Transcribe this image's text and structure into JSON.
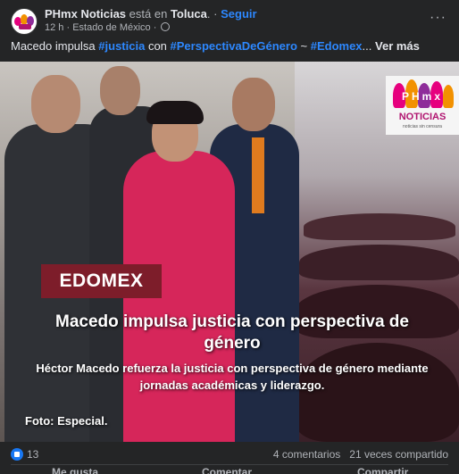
{
  "post": {
    "page_name": "PHmx Noticias",
    "status_text": "está en",
    "location": "Toluca",
    "separator": ".",
    "follow_label": "Seguir",
    "time": "12 h",
    "dot": "·",
    "region": "Estado de México",
    "more_label": "···",
    "caption": {
      "lead": "Macedo impulsa",
      "tag1": "#justicia",
      "mid": "con",
      "tag2": "#PerspectivaDeGénero",
      "tilde": "~",
      "tag3": "#Edomex",
      "ellipsis": "...",
      "see_more": "Ver más"
    }
  },
  "image": {
    "logo_text": "NOTICIAS",
    "logo_letters": "PHmx",
    "logo_small": "noticias sin censura",
    "badge": "EDOMEX",
    "headline": "Macedo impulsa justicia con perspectiva de género",
    "subhead": "Héctor Macedo refuerza la justicia con perspectiva de género mediante jornadas académicas y liderazgo.",
    "credit": "Foto: Especial."
  },
  "stats": {
    "likes": "13",
    "comments": "4 comentarios",
    "shares": "21 veces compartido"
  },
  "actions": {
    "like": "Me gusta",
    "comment": "Comentar",
    "share": "Compartir"
  },
  "colors": {
    "accent": "#2d88ff",
    "badge_bg": "#7d1d2a",
    "background": "#242526"
  }
}
